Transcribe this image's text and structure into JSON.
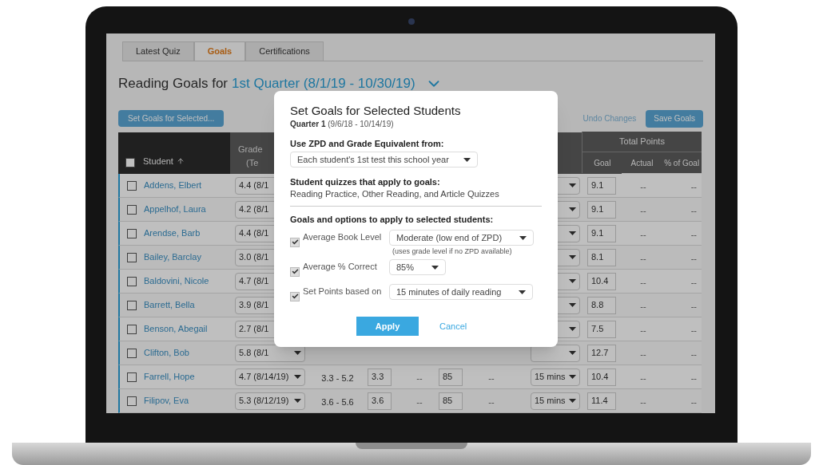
{
  "tabs": [
    {
      "label": "Latest Quiz",
      "selected": false
    },
    {
      "label": "Goals",
      "selected": true
    },
    {
      "label": "Certifications",
      "selected": false
    }
  ],
  "heading": {
    "prefix": "Reading Goals for",
    "period": "1st Quarter (8/1/19 - 10/30/19)"
  },
  "toolbar": {
    "set_goals": "Set Goals for Selected...",
    "undo": "Undo Changes",
    "save": "Save Goals"
  },
  "table": {
    "all_checked": false,
    "columns": {
      "student": "Student",
      "grade": "Grade",
      "grade_sub": "(Te",
      "total_points": "Total Points",
      "goal": "Goal",
      "actual": "Actual",
      "pct_goal": "% of Goal"
    },
    "rows": [
      {
        "name": "Addens, Elbert",
        "checked": false,
        "grade": "4.4 (8/1",
        "goal": "9.1",
        "actual": "--",
        "pct_goal": "--"
      },
      {
        "name": "Appelhof, Laura",
        "checked": false,
        "grade": "4.2 (8/1",
        "goal": "9.1",
        "actual": "--",
        "pct_goal": "--"
      },
      {
        "name": "Arendse, Barb",
        "checked": false,
        "grade": "4.4 (8/1",
        "goal": "9.1",
        "actual": "--",
        "pct_goal": "--"
      },
      {
        "name": "Bailey, Barclay",
        "checked": false,
        "grade": "3.0 (8/1",
        "goal": "8.1",
        "actual": "--",
        "pct_goal": "--"
      },
      {
        "name": "Baldovini, Nicole",
        "checked": false,
        "grade": "4.7 (8/1",
        "goal": "10.4",
        "actual": "--",
        "pct_goal": "--"
      },
      {
        "name": "Barrett, Bella",
        "checked": false,
        "grade": "3.9 (8/1",
        "goal": "8.8",
        "actual": "--",
        "pct_goal": "--"
      },
      {
        "name": "Benson, Abegail",
        "checked": false,
        "grade": "2.7 (8/1",
        "goal": "7.5",
        "actual": "--",
        "pct_goal": "--"
      },
      {
        "name": "Clifton, Bob",
        "checked": false,
        "grade": "5.8 (8/1",
        "goal": "12.7",
        "actual": "--",
        "pct_goal": "--"
      },
      {
        "name": "Farrell, Hope",
        "checked": false,
        "grade": "4.7 (8/14/19)",
        "zpd": "3.3 - 5.2",
        "book_level": "3.3",
        "book_actual": "--",
        "pct_correct": "85",
        "pct_actual": "--",
        "daily": "15 mins",
        "goal": "10.4",
        "actual": "--",
        "pct_goal": "--"
      },
      {
        "name": "Filipov, Eva",
        "checked": false,
        "grade": "5.3 (8/12/19)",
        "zpd": "3.6 - 5.6",
        "book_level": "3.6",
        "book_actual": "--",
        "pct_correct": "85",
        "pct_actual": "--",
        "daily": "15 mins",
        "goal": "11.4",
        "actual": "--",
        "pct_goal": "--"
      }
    ]
  },
  "dialog": {
    "title": "Set Goals for Selected Students",
    "quarter_label": "Quarter 1",
    "quarter_dates": "(9/6/18 - 10/14/19)",
    "source_label": "Use ZPD and Grade Equivalent from:",
    "source_value": "Each student's 1st test this school year",
    "quizzes_label": "Student quizzes that apply to goals:",
    "quizzes_text": "Reading Practice, Other Reading, and Article Quizzes",
    "options_label": "Goals and options to apply to selected students:",
    "options": [
      {
        "label": "Average Book Level",
        "checked": true,
        "value": "Moderate (low end of ZPD)",
        "note": "(uses grade level if no ZPD available)"
      },
      {
        "label": "Average % Correct",
        "checked": true,
        "value": "85%"
      },
      {
        "label": "Set Points based on",
        "checked": true,
        "value": "15 minutes of daily reading"
      }
    ],
    "apply": "Apply",
    "cancel": "Cancel"
  }
}
